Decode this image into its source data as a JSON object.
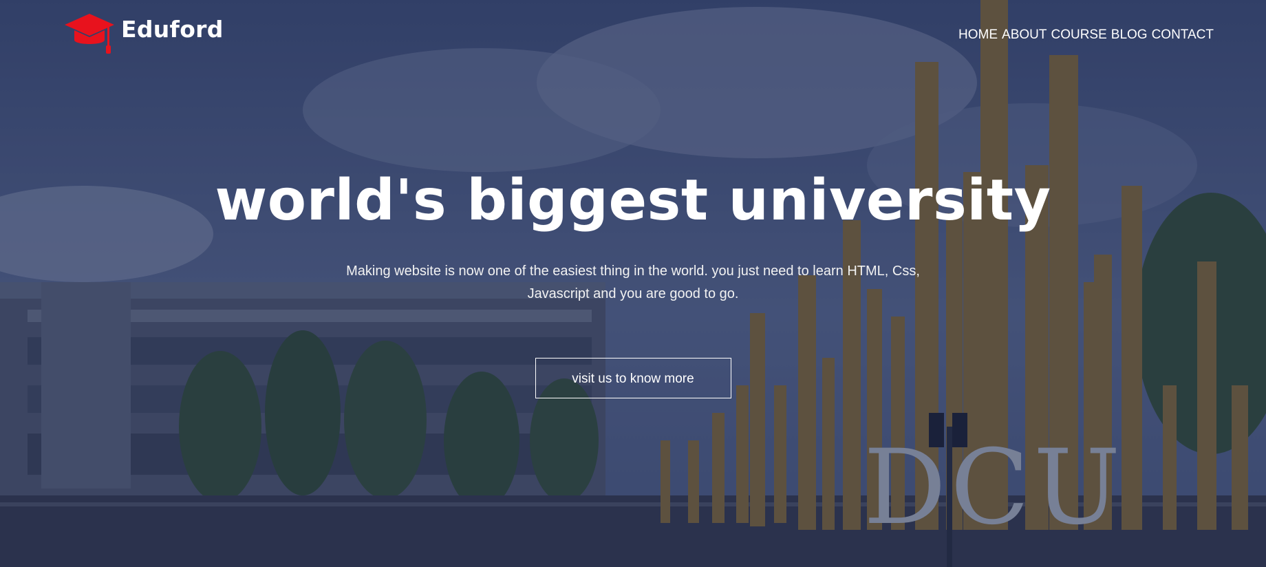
{
  "brand": {
    "name": "Eduford",
    "icon": "graduation-cap-icon",
    "accent_color": "#e8121d"
  },
  "nav": {
    "items": [
      {
        "label": "HOME"
      },
      {
        "label": "ABOUT"
      },
      {
        "label": "COURSE"
      },
      {
        "label": "BLOG"
      },
      {
        "label": "CONTACT"
      }
    ]
  },
  "hero": {
    "headline": "world's biggest university",
    "subtext": "Making website is now one of the easiest thing in the world. you just need to learn HTML, Css, Javascript and you are good to go.",
    "cta_label": "visit us to know more",
    "background_sign": "DCU"
  }
}
